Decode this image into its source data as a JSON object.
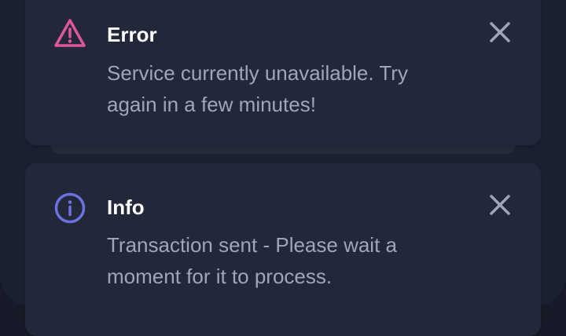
{
  "notifications": [
    {
      "type": "error",
      "title": "Error",
      "message": "Service currently unavailable. Try again in a few minutes!",
      "icon": "warning-triangle-icon",
      "accent_color": "#e0569c",
      "close_icon": "close-icon"
    },
    {
      "type": "info",
      "title": "Info",
      "message": "Transaction sent - Please wait a moment for it to process.",
      "icon": "info-circle-icon",
      "accent_color": "#6c72e0",
      "close_icon": "close-icon"
    }
  ],
  "colors": {
    "background": "#171b29",
    "card": "#222739",
    "title": "#ffffff",
    "message": "#9ea6b8",
    "close": "#9ea6b8"
  }
}
